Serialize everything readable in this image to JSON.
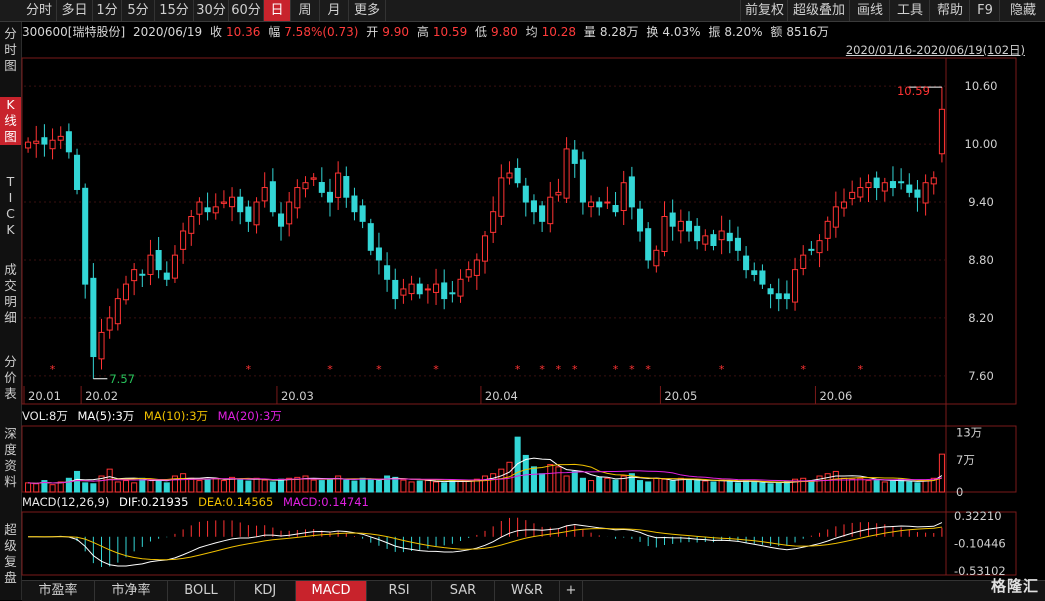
{
  "toolbar": {
    "tabs": [
      {
        "label": "分时",
        "active": false
      },
      {
        "label": "多日",
        "active": false
      },
      {
        "label": "1分",
        "active": false
      },
      {
        "label": "5分",
        "active": false
      },
      {
        "label": "15分",
        "active": false
      },
      {
        "label": "30分",
        "active": false
      },
      {
        "label": "60分",
        "active": false
      },
      {
        "label": "日",
        "active": true
      },
      {
        "label": "周",
        "active": false
      },
      {
        "label": "月",
        "active": false
      },
      {
        "label": "更多",
        "active": false
      }
    ],
    "right": [
      "前复权",
      "超级叠加",
      "画线",
      "工具",
      "帮助",
      "F9",
      "隐藏"
    ]
  },
  "left_nav": [
    {
      "label": "分时图",
      "active": false
    },
    {
      "label": "K线图",
      "active": true
    },
    {
      "label": "TICK",
      "active": false
    },
    {
      "label": "成交明细",
      "active": false
    },
    {
      "label": "分价表",
      "active": false
    },
    {
      "label": "深度资料",
      "active": false
    },
    {
      "label": "超级复盘",
      "active": false
    }
  ],
  "quote": {
    "code_name": "300600[瑞特股份]",
    "date": "2020/06/19",
    "close_label": "收",
    "close": "10.36",
    "change_label": "幅",
    "change": "7.58%(0.73)",
    "open_label": "开",
    "open": "9.90",
    "high_label": "高",
    "high": "10.59",
    "low_label": "低",
    "low": "9.80",
    "avg_label": "均",
    "avg": "10.28",
    "vol_label": "量",
    "vol": "8.28万",
    "turnover_label": "换",
    "turnover": "4.03%",
    "amp_label": "振",
    "amp": "8.20%",
    "amount_label": "额",
    "amount": "8516万"
  },
  "range": "2020/01/16-2020/06/19(102日)",
  "annotations": {
    "high": "10.59",
    "low": "7.57"
  },
  "vol_header": {
    "vol": "VOL:8万",
    "ma5": "MA(5):3万",
    "ma10": "MA(10):3万",
    "ma20": "MA(20):3万"
  },
  "macd_header": {
    "name": "MACD(12,26,9)",
    "dif": "DIF:0.21935",
    "dea": "DEA:0.14565",
    "macd": "MACD:0.14741"
  },
  "bottom_tabs": [
    {
      "label": "市盈率",
      "active": false
    },
    {
      "label": "市净率",
      "active": false
    },
    {
      "label": "BOLL",
      "active": false
    },
    {
      "label": "KDJ",
      "active": false
    },
    {
      "label": "MACD",
      "active": true
    },
    {
      "label": "RSI",
      "active": false
    },
    {
      "label": "SAR",
      "active": false
    },
    {
      "label": "W&R",
      "active": false
    },
    {
      "label": "+",
      "active": false
    }
  ],
  "logo": "格隆汇",
  "colors": {
    "up": "#ff3333",
    "down": "#33d6d6",
    "bg": "#000000",
    "active": "#c8232c",
    "ma5": "#ffffff",
    "ma10": "#f0c000",
    "ma20": "#e020e0"
  },
  "chart_data": {
    "type": "candlestick",
    "price_axis": {
      "ticks": [
        "10.60",
        "10.00",
        "9.40",
        "8.80",
        "8.20",
        "7.60"
      ],
      "min": 7.35,
      "max": 10.85
    },
    "date_labels": [
      {
        "label": "20.01",
        "i": 0
      },
      {
        "label": "20.02",
        "i": 7
      },
      {
        "label": "20.03",
        "i": 31
      },
      {
        "label": "20.04",
        "i": 56
      },
      {
        "label": "20.05",
        "i": 78
      },
      {
        "label": "20.06",
        "i": 97
      }
    ],
    "volume_axis": {
      "ticks": [
        "13万",
        "7万",
        "0"
      ],
      "max": 14
    },
    "macd_axis": {
      "ticks": [
        "0.32210",
        "-0.10446",
        "-0.53102"
      ],
      "min": -0.53102,
      "max": 0.3221
    },
    "star_indices": [
      3,
      27,
      37,
      43,
      50,
      60,
      63,
      65,
      67,
      72,
      74,
      76,
      85,
      95,
      102
    ],
    "closes": [
      10.02,
      10.03,
      10.0,
      10.04,
      10.08,
      9.92,
      9.53,
      8.55,
      7.8,
      8.05,
      8.2,
      8.4,
      8.55,
      8.7,
      8.65,
      8.85,
      8.7,
      8.6,
      8.85,
      9.1,
      9.25,
      9.4,
      9.3,
      9.35,
      9.4,
      9.45,
      9.3,
      9.2,
      9.4,
      9.55,
      9.3,
      9.15,
      9.4,
      9.55,
      9.6,
      9.65,
      9.5,
      9.4,
      9.7,
      9.45,
      9.3,
      9.2,
      8.9,
      8.8,
      8.6,
      8.4,
      8.5,
      8.55,
      8.45,
      8.5,
      8.55,
      8.4,
      8.45,
      8.6,
      8.7,
      8.8,
      9.05,
      9.3,
      9.65,
      9.7,
      9.6,
      9.4,
      9.3,
      9.2,
      9.45,
      9.5,
      9.95,
      9.8,
      9.4,
      9.4,
      9.35,
      9.4,
      9.3,
      9.6,
      9.35,
      9.1,
      8.8,
      8.9,
      9.25,
      9.15,
      9.2,
      9.1,
      9.0,
      9.05,
      8.95,
      9.1,
      9.0,
      8.9,
      8.7,
      8.65,
      8.55,
      8.45,
      8.4,
      8.4,
      8.7,
      8.85,
      8.9,
      9.0,
      9.2,
      9.35,
      9.4,
      9.5,
      9.55,
      9.6,
      9.55,
      9.6,
      9.55,
      9.6,
      9.5,
      9.45,
      9.6,
      9.65,
      10.36
    ],
    "volumes": [
      2.0,
      1.8,
      2.5,
      1.6,
      2.2,
      3.0,
      4.5,
      2.0,
      1.8,
      3.5,
      5.0,
      2.2,
      2.5,
      2.0,
      3.0,
      2.8,
      2.5,
      2.0,
      3.5,
      4.0,
      3.0,
      2.5,
      2.8,
      3.0,
      2.5,
      3.2,
      2.8,
      2.4,
      3.0,
      2.6,
      2.2,
      2.8,
      3.0,
      3.2,
      3.5,
      2.6,
      2.5,
      2.8,
      3.5,
      2.6,
      2.4,
      3.0,
      2.8,
      2.5,
      3.5,
      3.2,
      2.6,
      2.2,
      2.4,
      2.5,
      2.2,
      2.0,
      2.6,
      2.3,
      2.4,
      2.8,
      3.5,
      4.0,
      5.0,
      6.5,
      12.0,
      8.0,
      5.5,
      4.0,
      6.0,
      5.5,
      3.5,
      4.5,
      3.0,
      2.5,
      3.2,
      3.0,
      2.6,
      3.5,
      4.0,
      2.5,
      2.2,
      3.0,
      2.8,
      2.4,
      3.0,
      2.6,
      2.5,
      2.4,
      2.2,
      2.6,
      2.3,
      2.0,
      2.5,
      2.2,
      2.0,
      1.8,
      2.0,
      2.3,
      2.8,
      3.0,
      2.5,
      3.5,
      4.0,
      4.5,
      3.0,
      2.8,
      3.0,
      2.5,
      2.6,
      2.2,
      2.4,
      2.8,
      2.2,
      2.0,
      2.5,
      3.0,
      8.28
    ]
  }
}
